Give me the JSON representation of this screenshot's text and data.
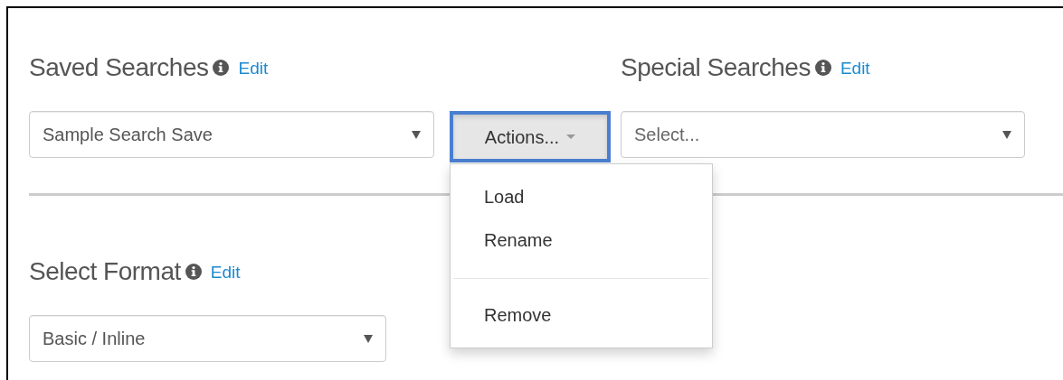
{
  "saved_searches": {
    "title": "Saved Searches",
    "edit_link": "Edit",
    "select": {
      "value": "Sample Search Save"
    }
  },
  "actions": {
    "label": "Actions...",
    "expanded": true,
    "menu": [
      {
        "kind": "item",
        "label": "Load"
      },
      {
        "kind": "item",
        "label": "Rename"
      },
      {
        "kind": "divider"
      },
      {
        "kind": "item",
        "label": "Remove"
      }
    ]
  },
  "special_searches": {
    "title": "Special Searches",
    "edit_link": "Edit",
    "select": {
      "placeholder": "Select..."
    }
  },
  "select_format": {
    "title": "Select Format",
    "edit_link": "Edit",
    "select": {
      "value": "Basic / Inline"
    }
  }
}
